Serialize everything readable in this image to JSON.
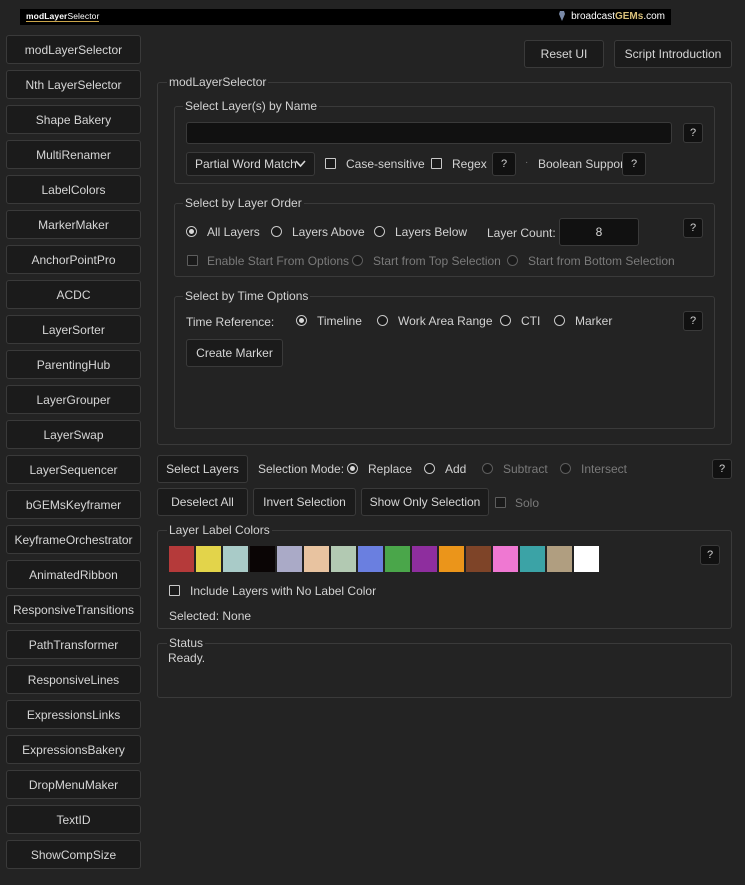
{
  "banner": {
    "logo_bold": "modLayer",
    "logo_thin": "Selector",
    "brand_prefix": "broadcast",
    "brand_gems": "GEMs",
    "brand_suffix": ".com"
  },
  "sidebar": {
    "items": [
      "modLayerSelector",
      "Nth LayerSelector",
      "Shape Bakery",
      "MultiRenamer",
      "LabelColors",
      "MarkerMaker",
      "AnchorPointPro",
      "ACDC",
      "LayerSorter",
      "ParentingHub",
      "LayerGrouper",
      "LayerSwap",
      "LayerSequencer",
      "bGEMsKeyframer",
      "KeyframeOrchestrator",
      "AnimatedRibbon",
      "ResponsiveTransitions",
      "PathTransformer",
      "ResponsiveLines",
      "ExpressionsLinks",
      "ExpressionsBakery",
      "DropMenuMaker",
      "TextID",
      "ShowCompSize"
    ]
  },
  "top_buttons": {
    "reset": "Reset UI",
    "intro": "Script Introduction"
  },
  "main_panel_title": "modLayerSelector",
  "by_name": {
    "title": "Select Layer(s) by Name",
    "input_value": "",
    "match_mode": "Partial Word Match",
    "case_sensitive": "Case-sensitive",
    "regex": "Regex",
    "boolean_support": "Boolean Support",
    "help": "?"
  },
  "by_order": {
    "title": "Select by Layer Order",
    "all_layers": "All Layers",
    "layers_above": "Layers Above",
    "layers_below": "Layers Below",
    "layer_count_label": "Layer Count:",
    "layer_count_value": "8",
    "enable_start": "Enable Start From Options",
    "start_top": "Start from Top Selection",
    "start_bottom": "Start from Bottom Selection",
    "help": "?"
  },
  "by_time": {
    "title": "Select by Time Options",
    "time_ref_label": "Time Reference:",
    "timeline": "Timeline",
    "work_area": "Work Area Range",
    "cti": "CTI",
    "marker": "Marker",
    "create_marker": "Create Marker",
    "help": "?"
  },
  "selection": {
    "select_layers": "Select Layers",
    "mode_label": "Selection Mode:",
    "replace": "Replace",
    "add": "Add",
    "subtract": "Subtract",
    "intersect": "Intersect",
    "help": "?",
    "deselect_all": "Deselect All",
    "invert": "Invert Selection",
    "show_only": "Show Only Selection",
    "solo": "Solo"
  },
  "label_colors": {
    "title": "Layer Label Colors",
    "colors": [
      "#b53a3a",
      "#e3d44a",
      "#a9cbc8",
      "#0a0505",
      "#aaaac7",
      "#e8c3a0",
      "#b2c9b2",
      "#6a7fe0",
      "#4aa64a",
      "#8e2e9e",
      "#eb951a",
      "#7e4428",
      "#ef78d2",
      "#3ba3a6",
      "#b09e80",
      "#ffffff"
    ],
    "include_no_label": "Include Layers with No Label Color",
    "selected": "Selected: None",
    "help": "?"
  },
  "status": {
    "title": "Status",
    "text": "Ready."
  }
}
